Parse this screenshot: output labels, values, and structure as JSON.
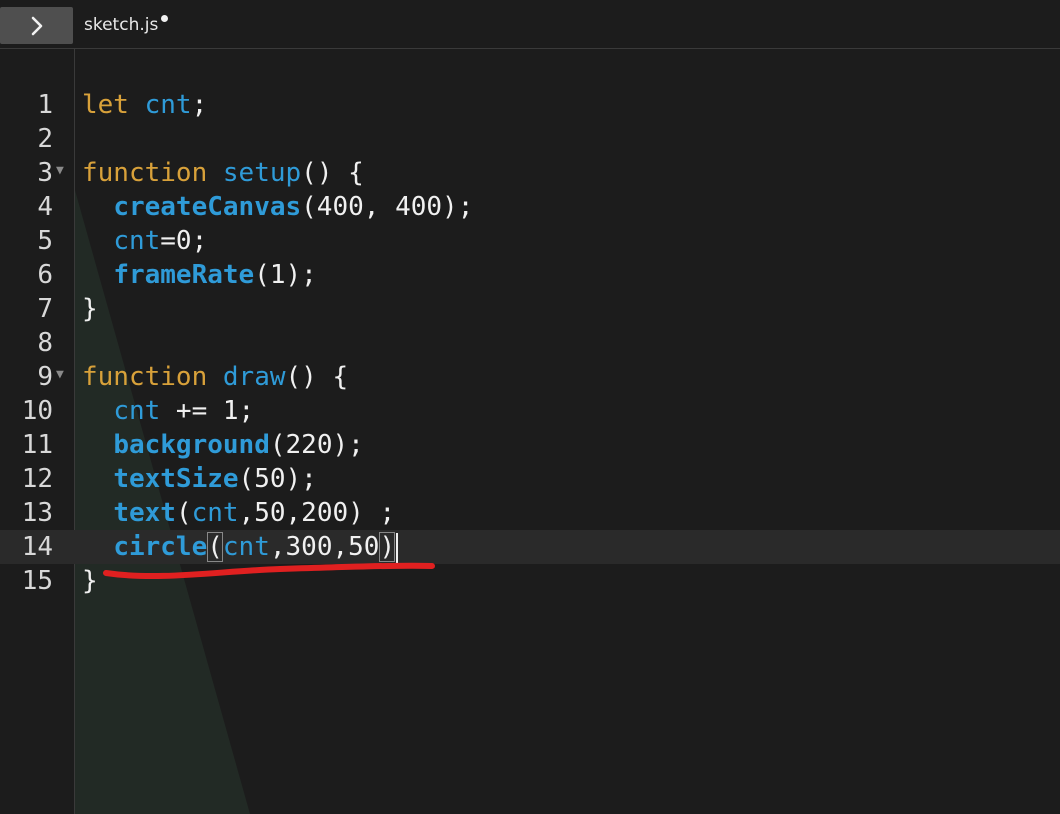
{
  "sidebar_toggle": {
    "icon": "chevron-right-icon"
  },
  "tab": {
    "filename": "sketch.js",
    "unsaved_indicator": "dot"
  },
  "colors": {
    "keyword": "#d8a13a",
    "identifier": "#2f9bd8",
    "text": "#f0f0f0",
    "background": "#1c1c1c",
    "annotation": "#e02020"
  },
  "editor": {
    "active_line": 14,
    "lines": [
      {
        "n": "1",
        "fold": "",
        "tokens": [
          {
            "t": "let",
            "c": "kw"
          },
          {
            "t": " ",
            "c": "punc"
          },
          {
            "t": "cnt",
            "c": "var"
          },
          {
            "t": ";",
            "c": "punc"
          }
        ]
      },
      {
        "n": "2",
        "fold": "",
        "tokens": []
      },
      {
        "n": "3",
        "fold": "▼",
        "tokens": [
          {
            "t": "function",
            "c": "kw"
          },
          {
            "t": " ",
            "c": "punc"
          },
          {
            "t": "setup",
            "c": "var"
          },
          {
            "t": "() {",
            "c": "punc"
          }
        ]
      },
      {
        "n": "4",
        "fold": "",
        "tokens": [
          {
            "t": "  ",
            "c": "punc"
          },
          {
            "t": "createCanvas",
            "c": "fn"
          },
          {
            "t": "(400, 400);",
            "c": "punc"
          }
        ]
      },
      {
        "n": "5",
        "fold": "",
        "tokens": [
          {
            "t": "  ",
            "c": "punc"
          },
          {
            "t": "cnt",
            "c": "var"
          },
          {
            "t": "=0;",
            "c": "punc"
          }
        ]
      },
      {
        "n": "6",
        "fold": "",
        "tokens": [
          {
            "t": "  ",
            "c": "punc"
          },
          {
            "t": "frameRate",
            "c": "fn"
          },
          {
            "t": "(1);",
            "c": "punc"
          }
        ]
      },
      {
        "n": "7",
        "fold": "",
        "tokens": [
          {
            "t": "}",
            "c": "punc"
          }
        ]
      },
      {
        "n": "8",
        "fold": "",
        "tokens": []
      },
      {
        "n": "9",
        "fold": "▼",
        "tokens": [
          {
            "t": "function",
            "c": "kw"
          },
          {
            "t": " ",
            "c": "punc"
          },
          {
            "t": "draw",
            "c": "var"
          },
          {
            "t": "() {",
            "c": "punc"
          }
        ]
      },
      {
        "n": "10",
        "fold": "",
        "tokens": [
          {
            "t": "  ",
            "c": "punc"
          },
          {
            "t": "cnt",
            "c": "var"
          },
          {
            "t": " += 1;",
            "c": "punc"
          }
        ]
      },
      {
        "n": "11",
        "fold": "",
        "tokens": [
          {
            "t": "  ",
            "c": "punc"
          },
          {
            "t": "background",
            "c": "fn"
          },
          {
            "t": "(220);",
            "c": "punc"
          }
        ]
      },
      {
        "n": "12",
        "fold": "",
        "tokens": [
          {
            "t": "  ",
            "c": "punc"
          },
          {
            "t": "textSize",
            "c": "fn"
          },
          {
            "t": "(50);",
            "c": "punc"
          }
        ]
      },
      {
        "n": "13",
        "fold": "",
        "tokens": [
          {
            "t": "  ",
            "c": "punc"
          },
          {
            "t": "text",
            "c": "fn"
          },
          {
            "t": "(",
            "c": "punc"
          },
          {
            "t": "cnt",
            "c": "var"
          },
          {
            "t": ",50,200) ;",
            "c": "punc"
          }
        ]
      },
      {
        "n": "14",
        "fold": "",
        "tokens": [
          {
            "t": "  ",
            "c": "punc"
          },
          {
            "t": "circle",
            "c": "fn"
          },
          {
            "t": "(",
            "c": "punc",
            "match": true
          },
          {
            "t": "cnt",
            "c": "var"
          },
          {
            "t": ",300,50",
            "c": "punc"
          },
          {
            "t": ")",
            "c": "punc",
            "match": true
          }
        ],
        "cursor": true
      },
      {
        "n": "15",
        "fold": "",
        "tokens": [
          {
            "t": "}",
            "c": "punc"
          }
        ]
      }
    ]
  }
}
